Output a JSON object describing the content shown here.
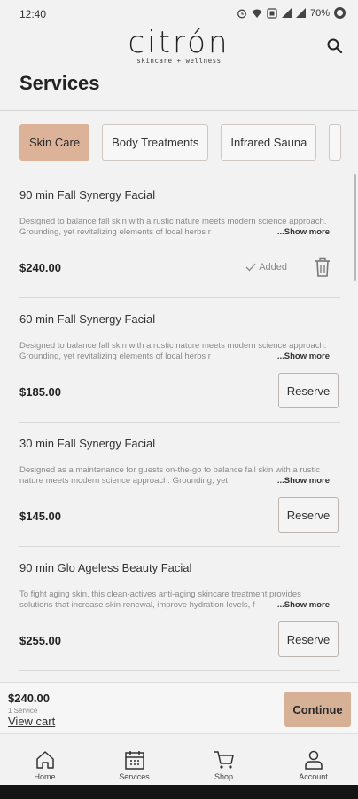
{
  "status": {
    "time": "12:40",
    "battery": "70%"
  },
  "header": {
    "logo_word": "citrón",
    "logo_tagline": "skincare + wellness",
    "title": "Services"
  },
  "categories": [
    {
      "label": "Skin Care",
      "active": true
    },
    {
      "label": "Body Treatments",
      "active": false
    },
    {
      "label": "Infrared Sauna",
      "active": false
    }
  ],
  "services": [
    {
      "title": "90 min  Fall Synergy Facial",
      "description": "Designed to balance fall skin with a rustic nature meets modern science approach. Grounding, yet revitalizing elements of local herbs r",
      "show_more": "...Show more",
      "price": "$240.00",
      "added_label": "Added"
    },
    {
      "title": "60 min  Fall Synergy Facial",
      "description": "Designed to balance fall skin with a rustic nature meets modern science approach. Grounding, yet revitalizing elements of local herbs r",
      "show_more": "...Show more",
      "price": "$185.00",
      "action": "Reserve"
    },
    {
      "title": "30 min  Fall Synergy Facial",
      "description": "Designed as a maintenance for guests on-the-go to balance fall skin with a rustic nature meets modern science approach. Grounding, yet",
      "show_more": "...Show more",
      "price": "$145.00",
      "action": "Reserve"
    },
    {
      "title": "90 min Glo Ageless Beauty Facial",
      "description": "To fight aging skin, this clean-actives anti-aging skincare treatment provides solutions that increase skin renewal, improve hydration levels, f",
      "show_more": "...Show more",
      "price": "$255.00",
      "action": "Reserve"
    }
  ],
  "cart": {
    "total": "$240.00",
    "count": "1 Service",
    "view_cart": "View cart",
    "continue": "Continue"
  },
  "nav": [
    {
      "label": "Home",
      "icon": "home-icon"
    },
    {
      "label": "Services",
      "icon": "calendar-icon"
    },
    {
      "label": "Shop",
      "icon": "cart-icon"
    },
    {
      "label": "Account",
      "icon": "person-icon"
    }
  ],
  "colors": {
    "accent": "#dcb398",
    "background": "#f2f2f2"
  }
}
